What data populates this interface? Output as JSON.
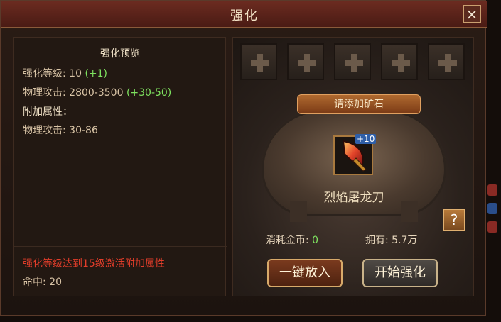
{
  "window": {
    "title": "强化"
  },
  "preview": {
    "header": "强化预览",
    "level_label": "强化等级:",
    "level_value": "10",
    "level_bonus": "(+1)",
    "attack_label": "物理攻击:",
    "attack_value": "2800-3500",
    "attack_bonus": "(+30-50)",
    "extra_label": "附加属性：",
    "extra_attack_label": "物理攻击:",
    "extra_attack_value": "30-86",
    "unlock_note": "强化等级达到15级激活附加属性",
    "hit_label": "命中:",
    "hit_value": "20"
  },
  "forge": {
    "add_ore_label": "请添加矿石",
    "item_plus": "+10",
    "item_name": "烈焰屠龙刀",
    "help_label": "?",
    "cost_label": "消耗金币:",
    "cost_value": "0",
    "owned_label": "拥有:",
    "owned_value": "5.7万",
    "one_click_label": "一键放入",
    "start_label": "开始强化"
  },
  "colors": {
    "green": "#7ee25f",
    "warning": "#e13d2a",
    "gold": "#d8aa6a"
  },
  "icons": {
    "close": "close-icon",
    "slot": "plus-icon",
    "weapon": "blade-icon"
  }
}
